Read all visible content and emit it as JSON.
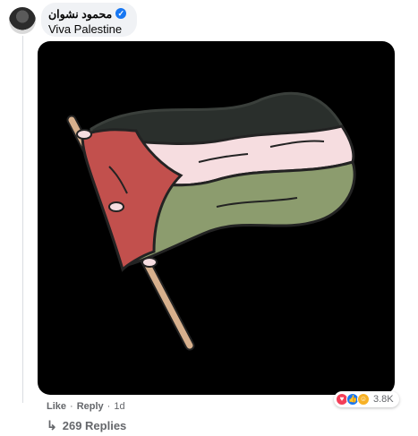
{
  "comment": {
    "author": "محمود نشوان",
    "verified_icon": "checkmark-icon",
    "text": "Viva Palestine"
  },
  "image": {
    "colors": {
      "background": "#000000",
      "red": "#c2504d",
      "white": "#f6dde0",
      "green": "#8c9c6e",
      "black_stripe": "#2a2f2c",
      "pole": "#d7b08d",
      "outline": "#232323"
    }
  },
  "actions": {
    "like": "Like",
    "separator": "·",
    "reply": "Reply",
    "time": "1d"
  },
  "reactions": {
    "icons": [
      "love-icon",
      "like-icon",
      "care-icon"
    ],
    "count": "3.8K"
  },
  "replies": {
    "label": "269 Replies"
  }
}
